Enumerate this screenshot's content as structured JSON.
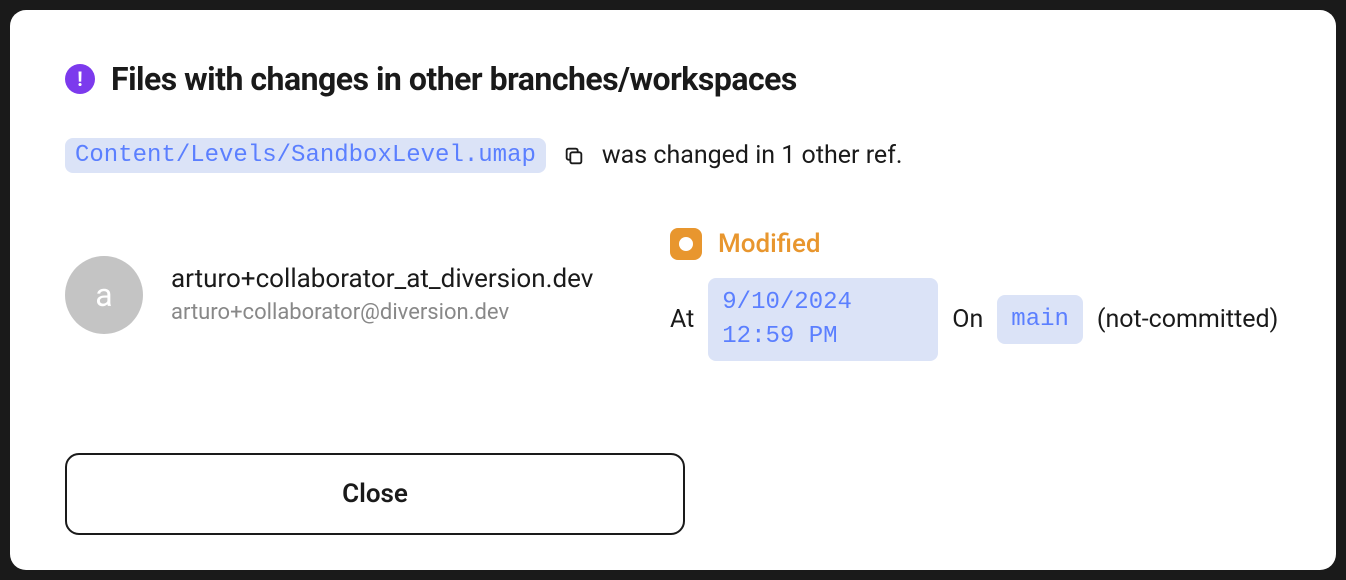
{
  "dialog": {
    "title": "Files with changes in other branches/workspaces",
    "file_path": "Content/Levels/SandboxLevel.umap",
    "changed_text": "was changed in 1 other ref.",
    "close_label": "Close"
  },
  "user": {
    "avatar_letter": "a",
    "name": "arturo+collaborator_at_diversion.dev",
    "email": "arturo+collaborator@diversion.dev"
  },
  "change": {
    "status": "Modified",
    "at_label": "At",
    "timestamp": "9/10/2024 12:59 PM",
    "on_label": "On",
    "branch": "main",
    "commit_status": "(not-committed)"
  }
}
